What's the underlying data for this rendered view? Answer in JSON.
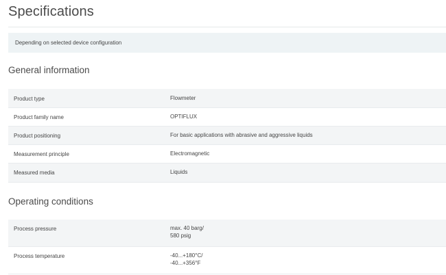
{
  "page_title": "Specifications",
  "note": "Depending on selected device configuration",
  "sections": [
    {
      "title": "General information",
      "rows": [
        {
          "label": "Product type",
          "value": [
            "Flowmeter"
          ]
        },
        {
          "label": "Product family name",
          "value": [
            "OPTIFLUX"
          ]
        },
        {
          "label": "Product positioning",
          "value": [
            "For basic applications with abrasive and aggressive liquids"
          ]
        },
        {
          "label": "Measurement principle",
          "value": [
            "Electromagnetic"
          ]
        },
        {
          "label": "Measured media",
          "value": [
            "Liquids"
          ]
        }
      ]
    },
    {
      "title": "Operating conditions",
      "rows": [
        {
          "label": "Process pressure",
          "value": [
            "max. 40 barg/",
            "580 psig"
          ]
        },
        {
          "label": "Process temperature",
          "value": [
            "-40...+180°C/",
            "-40...+356°F"
          ]
        }
      ]
    }
  ],
  "colors": {
    "note_background": "#eef3f5",
    "row_shaded": "#f3f5f6",
    "rule": "#e5e8ea"
  }
}
